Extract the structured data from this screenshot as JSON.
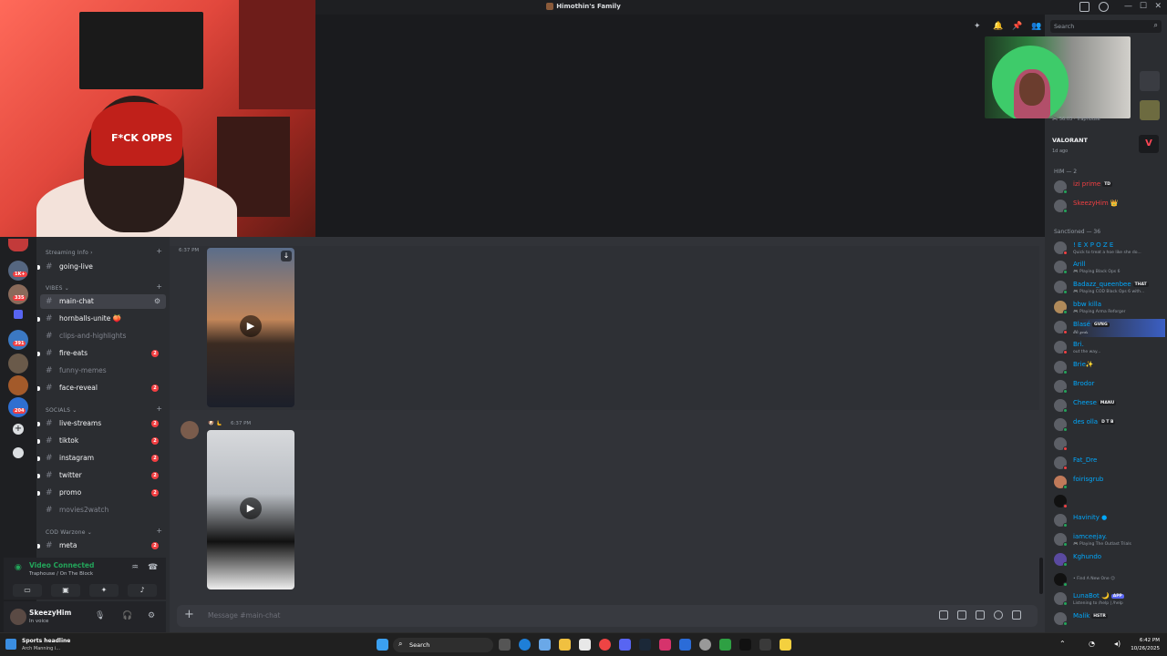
{
  "window": {
    "title": "Himothin's Family",
    "search_placeholder": "Search"
  },
  "webcam_overlay": {
    "cap_text": "F*CK OPPS"
  },
  "guilds": {
    "badges": [
      "1K+",
      "335",
      "391",
      "204"
    ]
  },
  "channels": {
    "categories": [
      {
        "label": "Streaming Info",
        "collapsed_marker": "›"
      },
      {
        "label": "VIBES",
        "collapsed_marker": "⌄"
      },
      {
        "label": "SOCIALS",
        "collapsed_marker": "⌄"
      },
      {
        "label": "COD Warzone",
        "collapsed_marker": "⌄"
      }
    ],
    "items": [
      {
        "name": "going-live",
        "unread": true,
        "badge": ""
      },
      {
        "name": "main-chat",
        "unread": true,
        "badge": "",
        "active": true
      },
      {
        "name": "hornballs-unite 🍑",
        "unread": true,
        "badge": ""
      },
      {
        "name": "clips-and-highlights",
        "unread": false,
        "badge": ""
      },
      {
        "name": "fire-eats",
        "unread": true,
        "badge": "2"
      },
      {
        "name": "funny-memes",
        "unread": false,
        "badge": ""
      },
      {
        "name": "face-reveal",
        "unread": true,
        "badge": "2"
      },
      {
        "name": "live-streams",
        "unread": true,
        "badge": "2"
      },
      {
        "name": "tiktok",
        "unread": true,
        "badge": "2"
      },
      {
        "name": "instagram",
        "unread": true,
        "badge": "2"
      },
      {
        "name": "twitter",
        "unread": true,
        "badge": "2"
      },
      {
        "name": "promo",
        "unread": true,
        "badge": "2"
      },
      {
        "name": "movies2watch",
        "unread": false,
        "badge": ""
      },
      {
        "name": "meta",
        "unread": true,
        "badge": "2"
      }
    ]
  },
  "voice": {
    "status": "Video Connected",
    "channel": "Traphouse / On The Block"
  },
  "user": {
    "name": "SkeezyHim",
    "status": "In voice"
  },
  "chat": {
    "messages": [
      {
        "time": "6:37 PM"
      },
      {
        "time": "6:37 PM",
        "author_emoji": "🐶 🫷"
      }
    ],
    "composer_placeholder": "Message #main-chat"
  },
  "members": {
    "activity": {
      "game": "VALORANT",
      "ago": "1d ago",
      "above": "🎮 56:03 · Traphouse"
    },
    "sections": [
      {
        "label": "HIM — 2"
      },
      {
        "label": "Sanctioned — 36"
      }
    ],
    "him": [
      {
        "name": "izi prime",
        "tag": "TD",
        "color": "red"
      },
      {
        "name": "SkeezyHim 👑",
        "tag": "",
        "color": "red"
      }
    ],
    "sanctioned": [
      {
        "name": "! E X P O Z E",
        "sub": "Quick to treat a hoe like she do..."
      },
      {
        "name": "Arill",
        "sub": "🎮 Playing Black Ops 6"
      },
      {
        "name": "Badazz_queenbee",
        "tag": "THAT",
        "sub": "🎮 Playing COD Black Ops 6 with..."
      },
      {
        "name": "bbw killa",
        "sub": "🎮 Playing Arma Reforger"
      },
      {
        "name": "Blasé",
        "tag": "GVNG",
        "sub": "𝓔𝓵𝓲 𝓰𝓸𝓭𝓼"
      },
      {
        "name": "Bri.",
        "sub": "out the way..."
      },
      {
        "name": "Brie✨",
        "sub": ""
      },
      {
        "name": "Brodor",
        "sub": ""
      },
      {
        "name": "Cheese",
        "tag": "MANU",
        "sub": ""
      },
      {
        "name": "des olla",
        "tag": "D T B",
        "sub": ""
      },
      {
        "name": "Fat_Dre",
        "sub": ""
      },
      {
        "name": "foirisgrub",
        "sub": ""
      },
      {
        "name": "Havinity ●",
        "sub": ""
      },
      {
        "name": "iamceejay.",
        "sub": "🎮 Playing The Outlast Trials"
      },
      {
        "name": "Kghundo",
        "sub": ""
      },
      {
        "name": "",
        "sub": "• Find A New One 😉"
      },
      {
        "name": "LunaBot 🌙",
        "tag": "APP",
        "sub": "Listening to /help | /help"
      },
      {
        "name": "Malik",
        "tag": "HSTR",
        "sub": ""
      }
    ]
  },
  "taskbar": {
    "news_title": "Sports headline",
    "news_sub": "Arch Manning i...",
    "search": "Search",
    "time": "6:42 PM",
    "date": "10/26/2025"
  },
  "colors": {
    "accent_green": "#23a55a",
    "mention_red": "#f23f42",
    "link_blue": "#00a8fc"
  }
}
